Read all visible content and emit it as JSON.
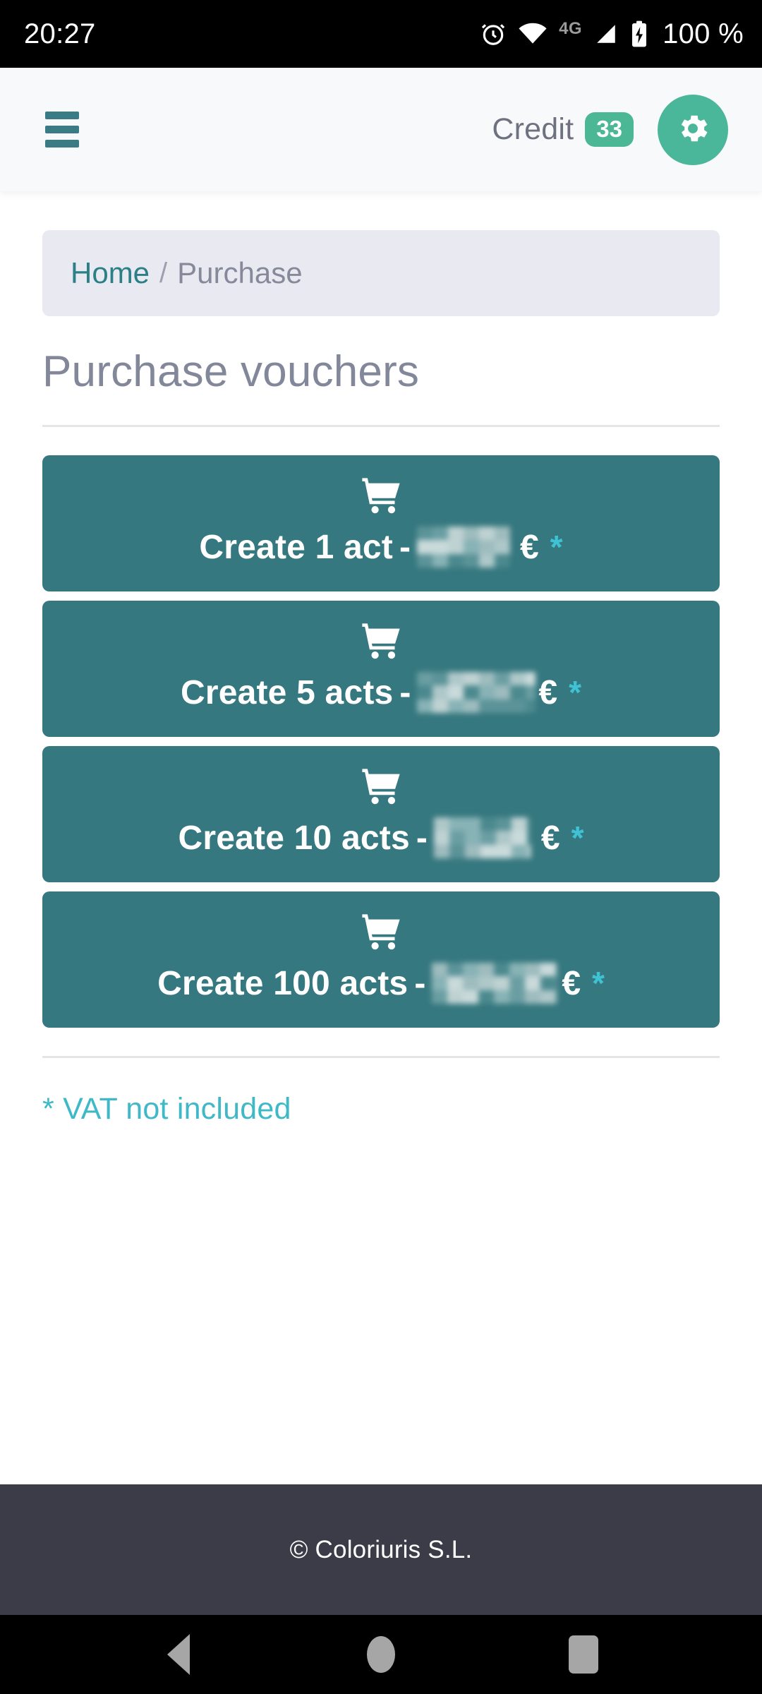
{
  "status_bar": {
    "time": "20:27",
    "network_label": "4G",
    "battery_text": "100 %",
    "icons": [
      "alarm-icon",
      "wifi-icon",
      "signal-icon",
      "battery-charging-icon"
    ]
  },
  "header": {
    "menu_icon": "hamburger-menu-icon",
    "credit_label": "Credit",
    "credit_value": "33",
    "settings_icon": "gear-icon",
    "accent_green": "#4bb79a",
    "accent_teal": "#3b7b86"
  },
  "breadcrumb": {
    "home": "Home",
    "separator": "/",
    "current": "Purchase"
  },
  "main": {
    "title": "Purchase vouchers",
    "currency": "€",
    "footnote_marker": "*",
    "dash": "-",
    "cart_icon": "shopping-cart-icon",
    "card_color": "#36787f",
    "star_color": "#3fc3d4",
    "vouchers": [
      {
        "label": "Create 1 act",
        "price": "",
        "price_hidden": true,
        "redact_width": 132
      },
      {
        "label": "Create 5 acts",
        "price": "",
        "price_hidden": true,
        "redact_width": 168
      },
      {
        "label": "Create 10 acts",
        "price": "",
        "price_hidden": true,
        "redact_width": 138
      },
      {
        "label": "Create 100 acts",
        "price": "",
        "price_hidden": true,
        "redact_width": 178
      }
    ],
    "vat_note": "* VAT not included",
    "vat_color": "#3fb8c8"
  },
  "footer": {
    "copyright": "© Coloriuris S.L.",
    "background": "#3b3c48"
  },
  "nav_bar": {
    "back": "back-button",
    "home": "home-button",
    "recents": "recents-button"
  }
}
